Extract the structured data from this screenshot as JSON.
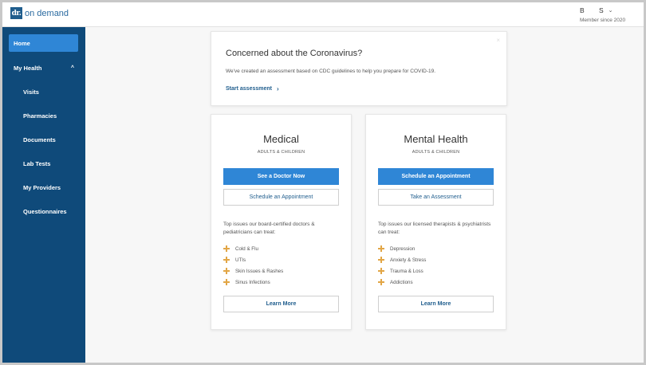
{
  "header": {
    "logo_mark": "dr.",
    "logo_text": "on demand",
    "user_first": "B",
    "user_last": "S",
    "chevron": "⌄",
    "member_since": "Member since 2020"
  },
  "sidebar": {
    "home": "Home",
    "my_health": "My Health",
    "items": [
      "Visits",
      "Pharmacies",
      "Documents",
      "Lab Tests",
      "My Providers",
      "Questionnaires"
    ]
  },
  "banner": {
    "close": "×",
    "title": "Concerned about the Coronavirus?",
    "body": "We've created an assessment based on CDC guidelines to help you prepare for COVID-19.",
    "link": "Start assessment",
    "link_arrow": "›"
  },
  "medical": {
    "title": "Medical",
    "subtitle": "ADULTS & CHILDREN",
    "primary_button": "See a Doctor Now",
    "secondary_button": "Schedule an Appointment",
    "description": "Top issues our board-certified doctors & pediatricians can treat:",
    "issues": [
      "Cold & Flu",
      "UTIs",
      "Skin Issues & Rashes",
      "Sinus Infections"
    ],
    "learn_more": "Learn More"
  },
  "mental": {
    "title": "Mental Health",
    "subtitle": "ADULTS & CHILDREN",
    "primary_button": "Schedule an Appointment",
    "secondary_button": "Take an Assessment",
    "description": "Top issues our licensed therapists & psychiatrists can treat:",
    "issues": [
      "Depression",
      "Anxiety & Stress",
      "Trauma & Loss",
      "Addictions"
    ],
    "learn_more": "Learn More"
  },
  "colors": {
    "sidebar_bg": "#0f4a7a",
    "active_item": "#2f86d6",
    "primary_button": "#2f86d6",
    "link": "#1f5d8d",
    "bullet_plus": "#e2a646"
  },
  "icons": {
    "user_menu": "chevron-down-icon",
    "my_health_toggle": "chevron-up-icon",
    "banner_close": "close-icon",
    "banner_link": "chevron-right-icon",
    "issue_bullet": "plus-icon"
  }
}
